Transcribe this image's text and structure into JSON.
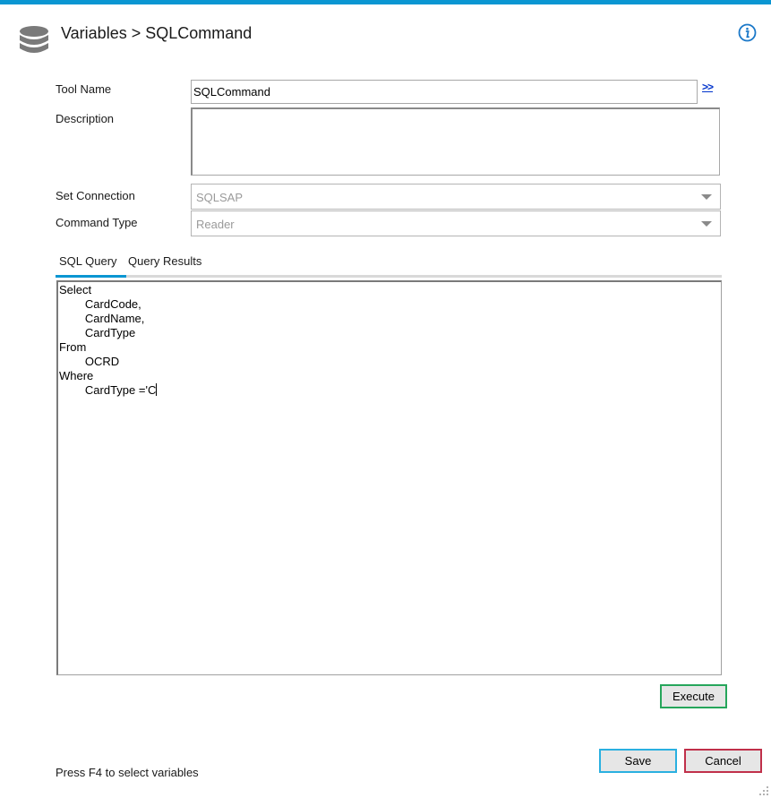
{
  "header": {
    "title": "Variables > SQLCommand",
    "icon": "database-icon",
    "info_icon": "info-icon"
  },
  "form": {
    "tool_name_label": "Tool Name",
    "tool_name_value": "SQLCommand",
    "expand_link": ">>",
    "description_label": "Description",
    "description_value": "",
    "set_connection_label": "Set Connection",
    "set_connection_value": "SQLSAP",
    "command_type_label": "Command Type",
    "command_type_value": "Reader"
  },
  "tabs": [
    {
      "label": "SQL Query",
      "active": true
    },
    {
      "label": "Query Results",
      "active": false
    }
  ],
  "sql_query": {
    "lines": [
      "Select",
      "        CardCode,",
      "        CardName,",
      "        CardType",
      "From",
      "        OCRD",
      "Where",
      "        CardType ='C"
    ]
  },
  "buttons": {
    "execute": "Execute",
    "save": "Save",
    "cancel": "Cancel"
  },
  "footer": {
    "hint": "Press F4 to select variables"
  },
  "colors": {
    "accent": "#0a96d2",
    "execute_border": "#26a65b",
    "save_border": "#2ab0e0",
    "cancel_border": "#c0304a"
  }
}
